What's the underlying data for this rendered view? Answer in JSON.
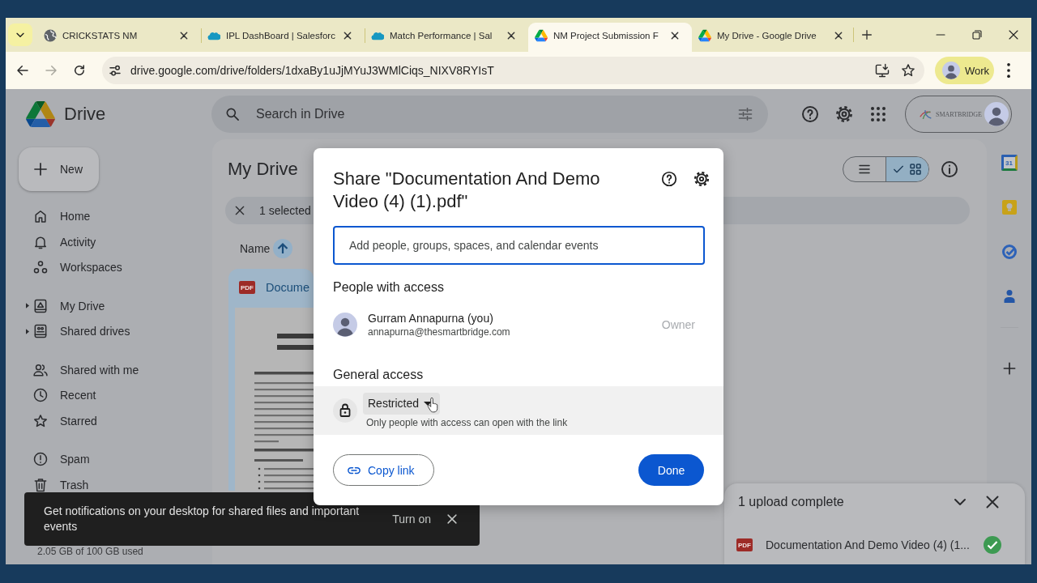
{
  "browser": {
    "tabs": [
      {
        "title": "CRICKSTATS NM",
        "selected": false
      },
      {
        "title": "IPL DashBoard | Salesforc",
        "selected": false
      },
      {
        "title": "Match Performance | Sal",
        "selected": false
      },
      {
        "title": "NM Project Submission F",
        "selected": true
      },
      {
        "title": "My Drive - Google Drive",
        "selected": false
      }
    ],
    "forward_disabled": true,
    "url": "drive.google.com/drive/folders/1dxaBy1uJjMYuJ3WMlCiqs_NIXV8RYIsT",
    "profile": "Work"
  },
  "drive": {
    "app_name": "Drive",
    "search_placeholder": "Search in Drive",
    "account_logo": "SMARTBRIDGE",
    "new_button": "New",
    "nav_groups": [
      {
        "items": [
          {
            "label": "Home",
            "has_children": false
          },
          {
            "label": "Activity",
            "has_children": false
          },
          {
            "label": "Workspaces",
            "has_children": false
          }
        ]
      },
      {
        "items": [
          {
            "label": "My Drive",
            "has_children": true
          },
          {
            "label": "Shared drives",
            "has_children": true
          }
        ]
      },
      {
        "items": [
          {
            "label": "Shared with me",
            "has_children": false
          },
          {
            "label": "Recent",
            "has_children": false
          },
          {
            "label": "Starred",
            "has_children": false
          }
        ]
      },
      {
        "items": [
          {
            "label": "Spam",
            "has_children": false
          },
          {
            "label": "Trash",
            "has_children": false
          }
        ]
      }
    ],
    "storage": "2.05 GB of 100 GB used",
    "heading": "My Drive",
    "view_modes": [
      {
        "selected": false
      },
      {
        "selected": true
      }
    ],
    "selection": "1 selected",
    "sort": {
      "label": "Name"
    },
    "files": [
      {
        "name": "Docume",
        "type_badge": "PDF"
      }
    ],
    "calendar_day": "31"
  },
  "share_dialog": {
    "title": "Share \"Documentation And Demo Video (4) (1).pdf\"",
    "input_placeholder": "Add people, groups, spaces, and calendar events",
    "people_heading": "People with access",
    "people": [
      {
        "name": "Gurram Annapurna (you)",
        "email": "annapurna@thesmartbridge.com",
        "role": "Owner",
        "role_disabled": true
      }
    ],
    "general_heading": "General access",
    "access": {
      "level": "Restricted",
      "description": "Only people with access can open with the link",
      "hovered": true
    },
    "copy_link": "Copy link",
    "done": "Done"
  },
  "snackbar": {
    "message": "Get notifications on your desktop for shared files and important events",
    "action": "Turn on"
  },
  "upload_panel": {
    "title": "1 upload complete",
    "items": [
      {
        "name": "Documentation And Demo Video (4) (1...",
        "type_badge": "PDF",
        "complete": true
      }
    ]
  }
}
